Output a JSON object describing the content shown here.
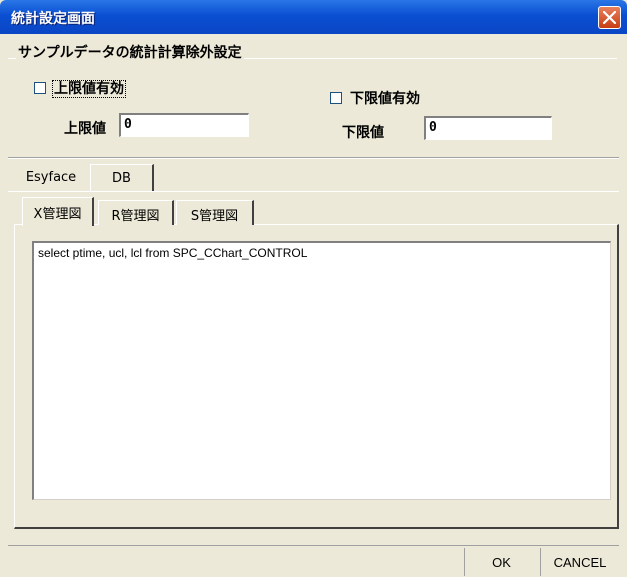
{
  "window": {
    "title": "統計設定画面"
  },
  "group": {
    "title": "サンプルデータの統計計算除外設定",
    "upper_checkbox_label": "上限値有効",
    "lower_checkbox_label": "下限値有効",
    "upper_label": "上限値",
    "lower_label": "下限値",
    "upper_value": "0",
    "lower_value": "0"
  },
  "tabs_primary": [
    {
      "label": "Esyface"
    },
    {
      "label": "DB"
    }
  ],
  "tabs_secondary": [
    {
      "label": "X管理図"
    },
    {
      "label": "R管理図"
    },
    {
      "label": "S管理図"
    }
  ],
  "sql": {
    "text": "select ptime, ucl, lcl from SPC_CChart_CONTROL"
  },
  "buttons": {
    "ok": "OK",
    "cancel": "CANCEL"
  }
}
